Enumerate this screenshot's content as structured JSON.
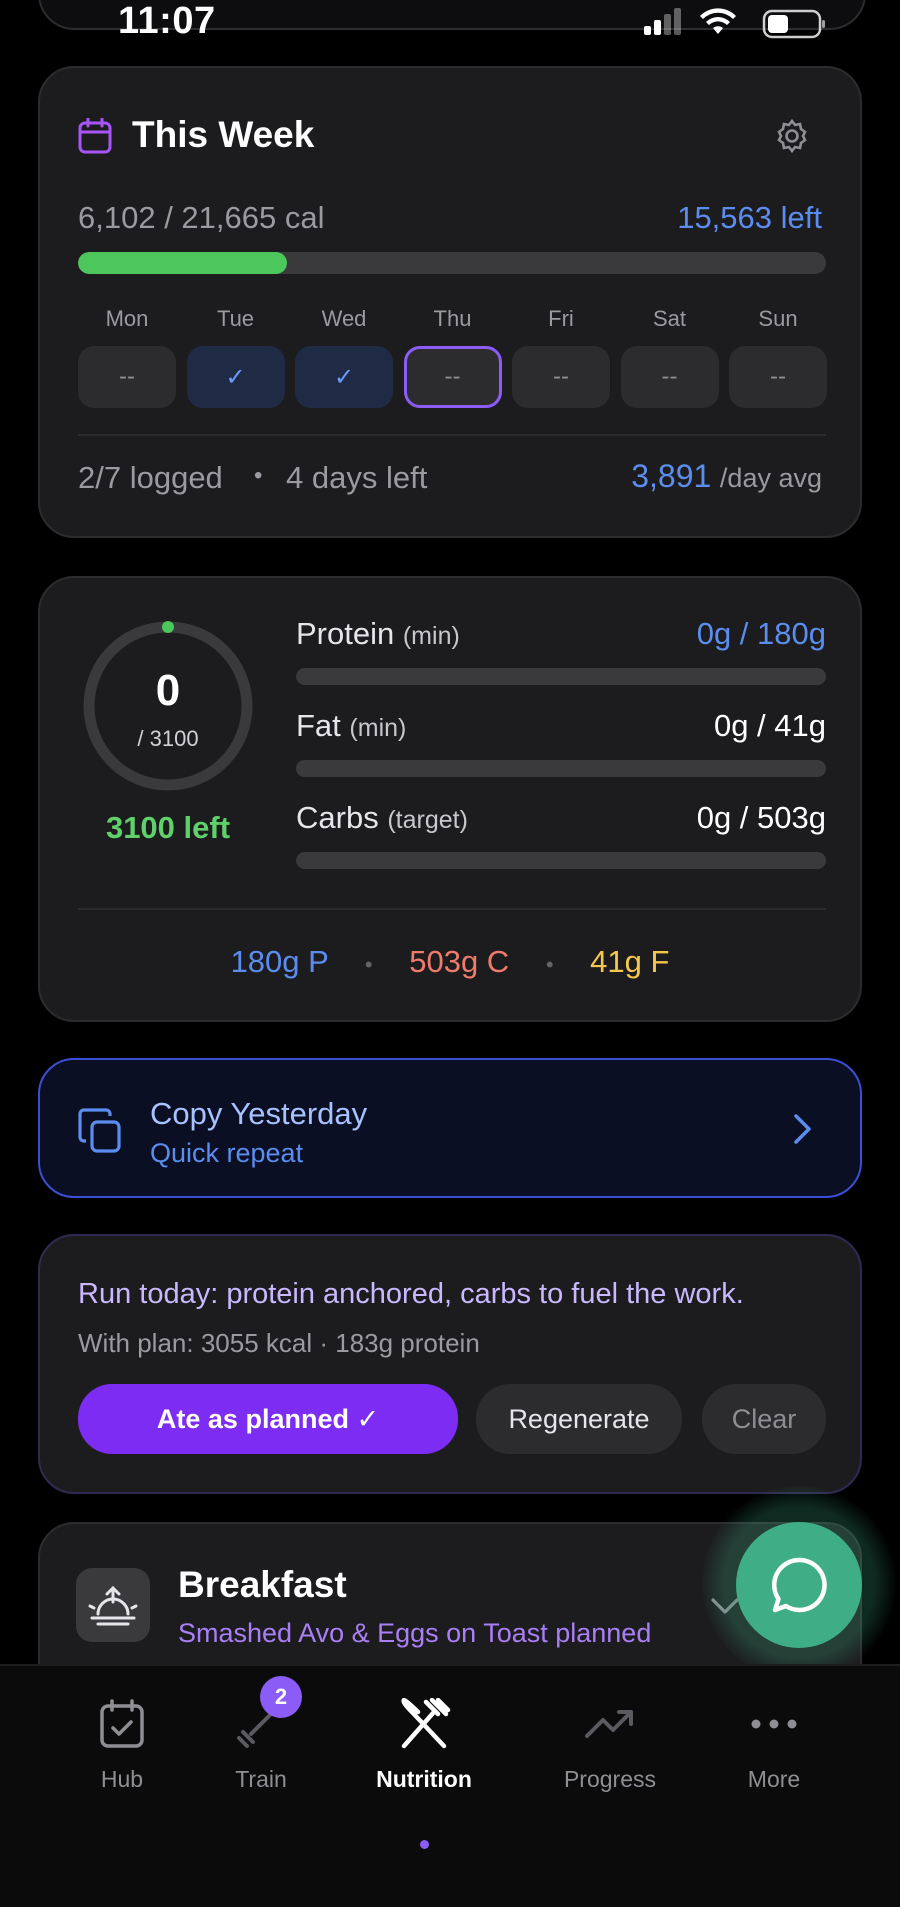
{
  "status": {
    "time": "11:07"
  },
  "week": {
    "title": "This Week",
    "calories_text": "6,102 / 21,665 cal",
    "left_text": "15,563 left",
    "progress": 0.28,
    "days": [
      {
        "label": "Mon",
        "value": "--",
        "state": "empty"
      },
      {
        "label": "Tue",
        "value": "✓",
        "state": "done"
      },
      {
        "label": "Wed",
        "value": "✓",
        "state": "done"
      },
      {
        "label": "Thu",
        "value": "--",
        "state": "today"
      },
      {
        "label": "Fri",
        "value": "--",
        "state": "empty"
      },
      {
        "label": "Sat",
        "value": "--",
        "state": "empty"
      },
      {
        "label": "Sun",
        "value": "--",
        "state": "empty"
      }
    ],
    "logged": "2/7 logged",
    "separator": "•",
    "days_left": "4 days left",
    "avg_value": "3,891",
    "avg_unit": "/day avg"
  },
  "today": {
    "ring_value": "0",
    "ring_total": "/ 3100",
    "left": "3100 left",
    "macros": [
      {
        "name": "Protein",
        "qualifier": "(min)",
        "value": "0g / 180g",
        "color": "#5b8def"
      },
      {
        "name": "Fat",
        "qualifier": "(min)",
        "value": "0g / 41g",
        "color": "#ffffff"
      },
      {
        "name": "Carbs",
        "qualifier": "(target)",
        "value": "0g / 503g",
        "color": "#ffffff"
      }
    ],
    "targets": {
      "protein": "180g P",
      "carbs": "503g C",
      "fat": "41g F",
      "dot": "•"
    }
  },
  "copy": {
    "title": "Copy Yesterday",
    "subtitle": "Quick repeat"
  },
  "plan": {
    "headline": "Run today: protein anchored, carbs to fuel the work.",
    "detail": "With plan: 3055 kcal · 183g protein",
    "ate_button": "Ate as planned ✓",
    "regenerate_button": "Regenerate",
    "clear_button": "Clear"
  },
  "meal": {
    "title": "Breakfast",
    "subtitle": "Smashed Avo & Eggs on Toast planned"
  },
  "tabs": [
    {
      "label": "Hub"
    },
    {
      "label": "Train",
      "badge": "2"
    },
    {
      "label": "Nutrition"
    },
    {
      "label": "Progress"
    },
    {
      "label": "More"
    }
  ],
  "colors": {
    "accent": "#8b5cf6",
    "blue": "#5b8def",
    "green": "#4cc75b",
    "red": "#f07b6b",
    "yellow": "#f5c84b"
  }
}
